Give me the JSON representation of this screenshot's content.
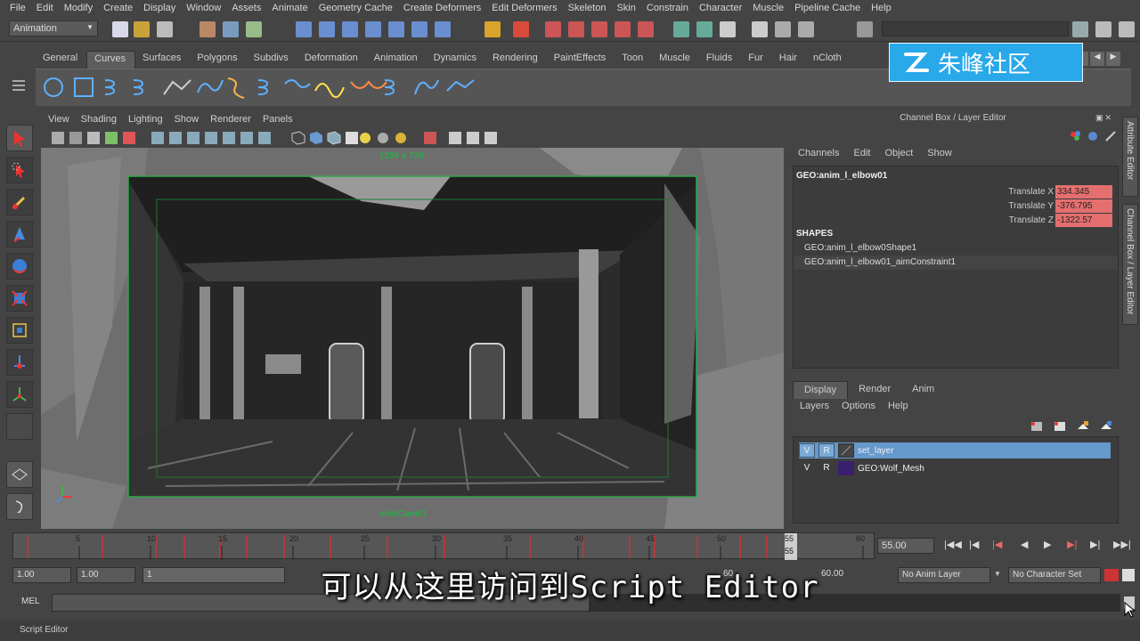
{
  "menubar": {
    "items": [
      "File",
      "Edit",
      "Modify",
      "Create",
      "Display",
      "Window",
      "Assets",
      "Animate",
      "Geometry Cache",
      "Create Deformers",
      "Edit Deformers",
      "Skeleton",
      "Skin",
      "Constrain",
      "Character",
      "Muscle",
      "Pipeline Cache",
      "Help"
    ]
  },
  "statusline": {
    "mode": "Animation"
  },
  "shelf": {
    "tabs": [
      "General",
      "Curves",
      "Surfaces",
      "Polygons",
      "Subdivs",
      "Deformation",
      "Animation",
      "Dynamics",
      "Rendering",
      "PaintEffects",
      "Toon",
      "Muscle",
      "Fluids",
      "Fur",
      "Hair",
      "nCloth"
    ],
    "active_tab": "Curves"
  },
  "viewport": {
    "menu": [
      "View",
      "Shading",
      "Lighting",
      "Show",
      "Renderer",
      "Panels"
    ],
    "resolution_label": "1280 x 720",
    "camera_label": "shotCam01"
  },
  "channel_box": {
    "title": "Channel Box / Layer Editor",
    "menu": [
      "Channels",
      "Edit",
      "Object",
      "Show"
    ],
    "object_name": "GEO:anim_l_elbow01",
    "attributes": [
      {
        "label": "Translate X",
        "value": "334.345"
      },
      {
        "label": "Translate Y",
        "value": "-376.795"
      },
      {
        "label": "Translate Z",
        "value": "-1322.57"
      }
    ],
    "shapes_header": "SHAPES",
    "shapes": [
      "GEO:anim_l_elbow0Shape1",
      "GEO:anim_l_elbow01_aimConstraint1"
    ]
  },
  "layer_editor": {
    "tabs": [
      "Display",
      "Render",
      "Anim"
    ],
    "active_tab": "Display",
    "menu": [
      "Layers",
      "Options",
      "Help"
    ],
    "layers": [
      {
        "v": "V",
        "r": "R",
        "name": "set_layer",
        "color": "#6699cc"
      },
      {
        "v": "V",
        "r": "R",
        "name": "GEO:Wolf_Mesh",
        "color": "#3a1f6e"
      }
    ]
  },
  "side_tabs": [
    "Attribute Editor",
    "Channel Box / Layer Editor"
  ],
  "timeline": {
    "ticks": [
      "5",
      "10",
      "15",
      "20",
      "25",
      "30",
      "35",
      "40",
      "45",
      "50",
      "55",
      "60"
    ],
    "current_frame_marker": "55",
    "current_frame_field": "55.00"
  },
  "range_slider": {
    "start_value": "1.00",
    "start_range": "1.00",
    "range_handle_label": "1",
    "end_partial_1": "60",
    "end_partial_2": "60.00",
    "anim_layer": "No Anim Layer",
    "character_set": "No Character Set"
  },
  "command_line": {
    "label": "MEL"
  },
  "help_line": {
    "text": "Script Editor"
  },
  "subtitle": {
    "text": "可以从这里访问到Script Editor"
  },
  "watermark": {
    "text": "朱峰社区"
  },
  "colors": {
    "ui_bg": "#444444",
    "attr_highlight": "#e46f6f",
    "layer_selected": "#6699cc",
    "keyframe_red": "#d03030",
    "watermark_blue": "#29a8ea"
  }
}
